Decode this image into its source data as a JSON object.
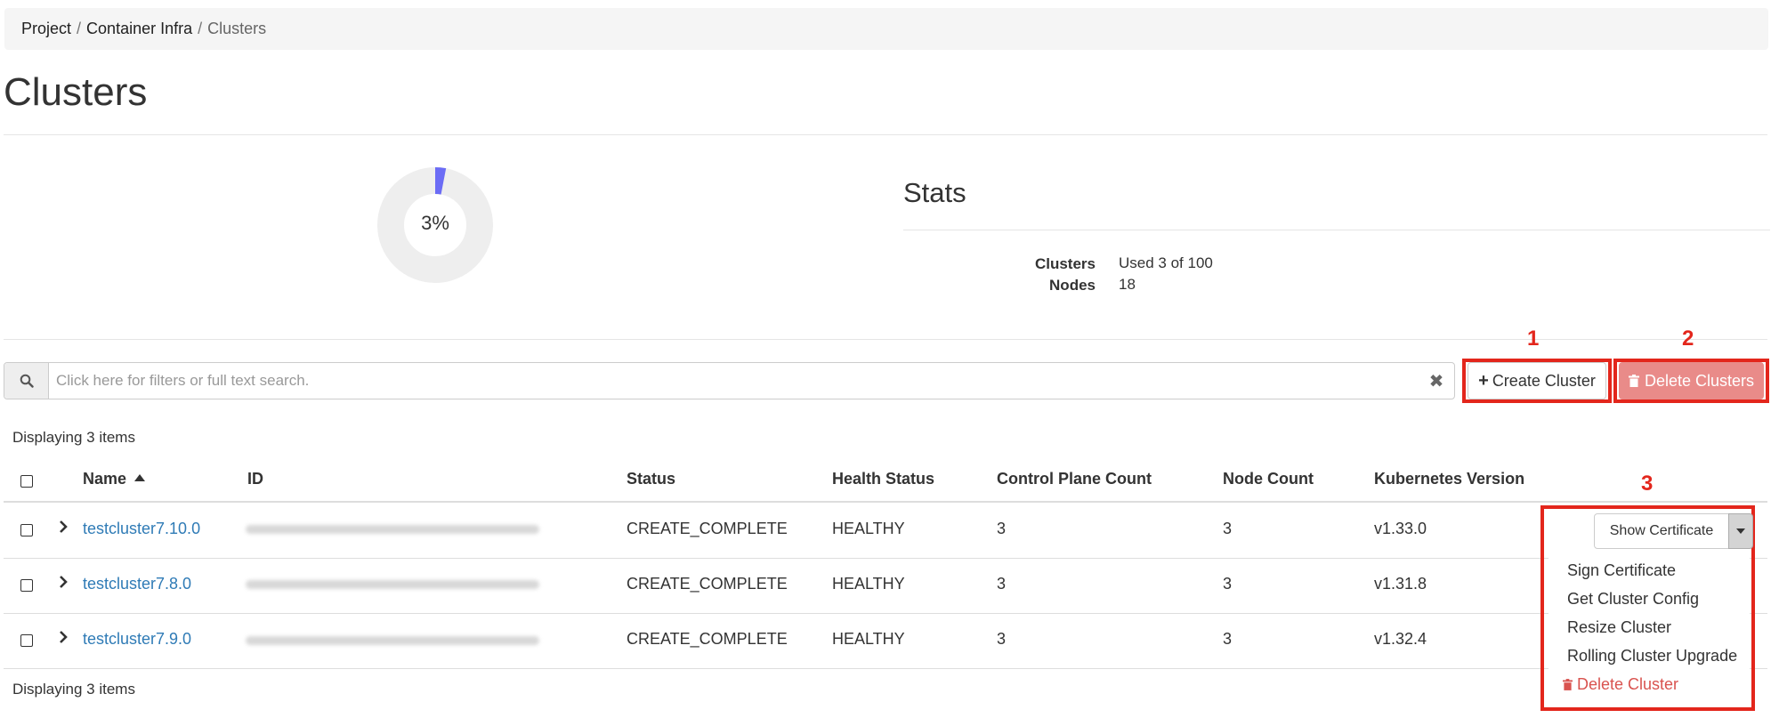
{
  "breadcrumb": [
    "Project",
    "Container Infra",
    "Clusters"
  ],
  "page_title": "Clusters",
  "quota_chart": {
    "percent_label": "3%",
    "used_fraction": 0.03,
    "fill_color": "#6b6cf5",
    "track_color": "#eeeeee"
  },
  "stats": {
    "title": "Stats",
    "rows": [
      {
        "label": "Clusters",
        "value": "Used 3 of 100"
      },
      {
        "label": "Nodes",
        "value": "18"
      }
    ]
  },
  "search": {
    "placeholder": "Click here for filters or full text search."
  },
  "actions": {
    "create_label": "Create Cluster",
    "delete_label": "Delete Clusters"
  },
  "callouts": [
    "1",
    "2",
    "3"
  ],
  "displaying_text": "Displaying 3 items",
  "table": {
    "columns": [
      "Name",
      "ID",
      "Status",
      "Health Status",
      "Control Plane Count",
      "Node Count",
      "Kubernetes Version"
    ],
    "rows": [
      {
        "name": "testcluster7.10.0",
        "status": "CREATE_COMPLETE",
        "health": "HEALTHY",
        "control_plane": "3",
        "nodes": "3",
        "version": "v1.33.0"
      },
      {
        "name": "testcluster7.8.0",
        "status": "CREATE_COMPLETE",
        "health": "HEALTHY",
        "control_plane": "3",
        "nodes": "3",
        "version": "v1.31.8"
      },
      {
        "name": "testcluster7.9.0",
        "status": "CREATE_COMPLETE",
        "health": "HEALTHY",
        "control_plane": "3",
        "nodes": "3",
        "version": "v1.32.4"
      }
    ]
  },
  "row_actions": {
    "primary_label": "Show Certificate",
    "menu": [
      "Sign Certificate",
      "Get Cluster Config",
      "Resize Cluster",
      "Rolling Cluster Upgrade",
      "Delete Cluster"
    ]
  },
  "colors": {
    "link": "#2f7bb6",
    "danger": "#d9534f",
    "callout": "#e3261c"
  }
}
